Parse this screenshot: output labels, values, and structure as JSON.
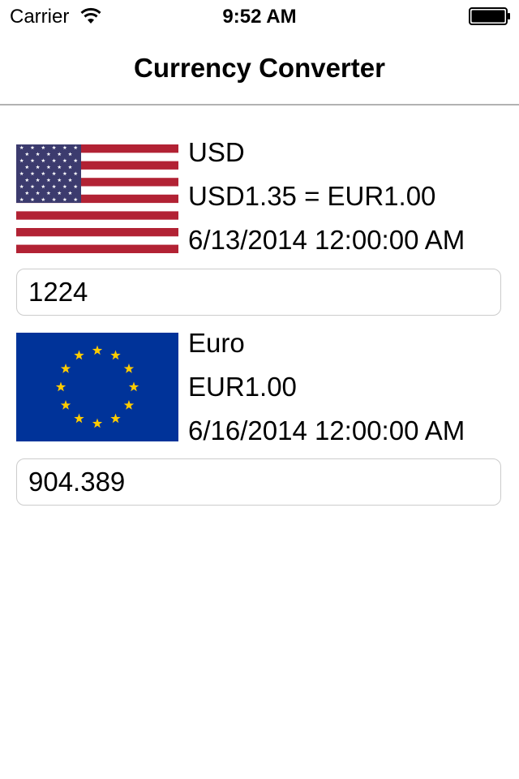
{
  "status_bar": {
    "carrier": "Carrier",
    "time": "9:52 AM",
    "wifi_icon": "wifi-icon",
    "battery_icon": "battery-full-icon"
  },
  "nav": {
    "title": "Currency Converter"
  },
  "currencies": [
    {
      "name": "USD",
      "rate": "USD1.35 = EUR1.00",
      "date": "6/13/2014 12:00:00 AM",
      "amount": "1224",
      "flag_icon": "us-flag-icon"
    },
    {
      "name": "Euro",
      "rate": "EUR1.00",
      "date": "6/16/2014 12:00:00 AM",
      "amount": "904.389",
      "flag_icon": "eu-flag-icon"
    }
  ],
  "colors": {
    "us_red": "#b22234",
    "us_blue": "#3c3b6e",
    "eu_blue": "#003399",
    "eu_gold": "#ffcc00",
    "separator": "#b2b2b2",
    "field_border": "#cccccc"
  }
}
